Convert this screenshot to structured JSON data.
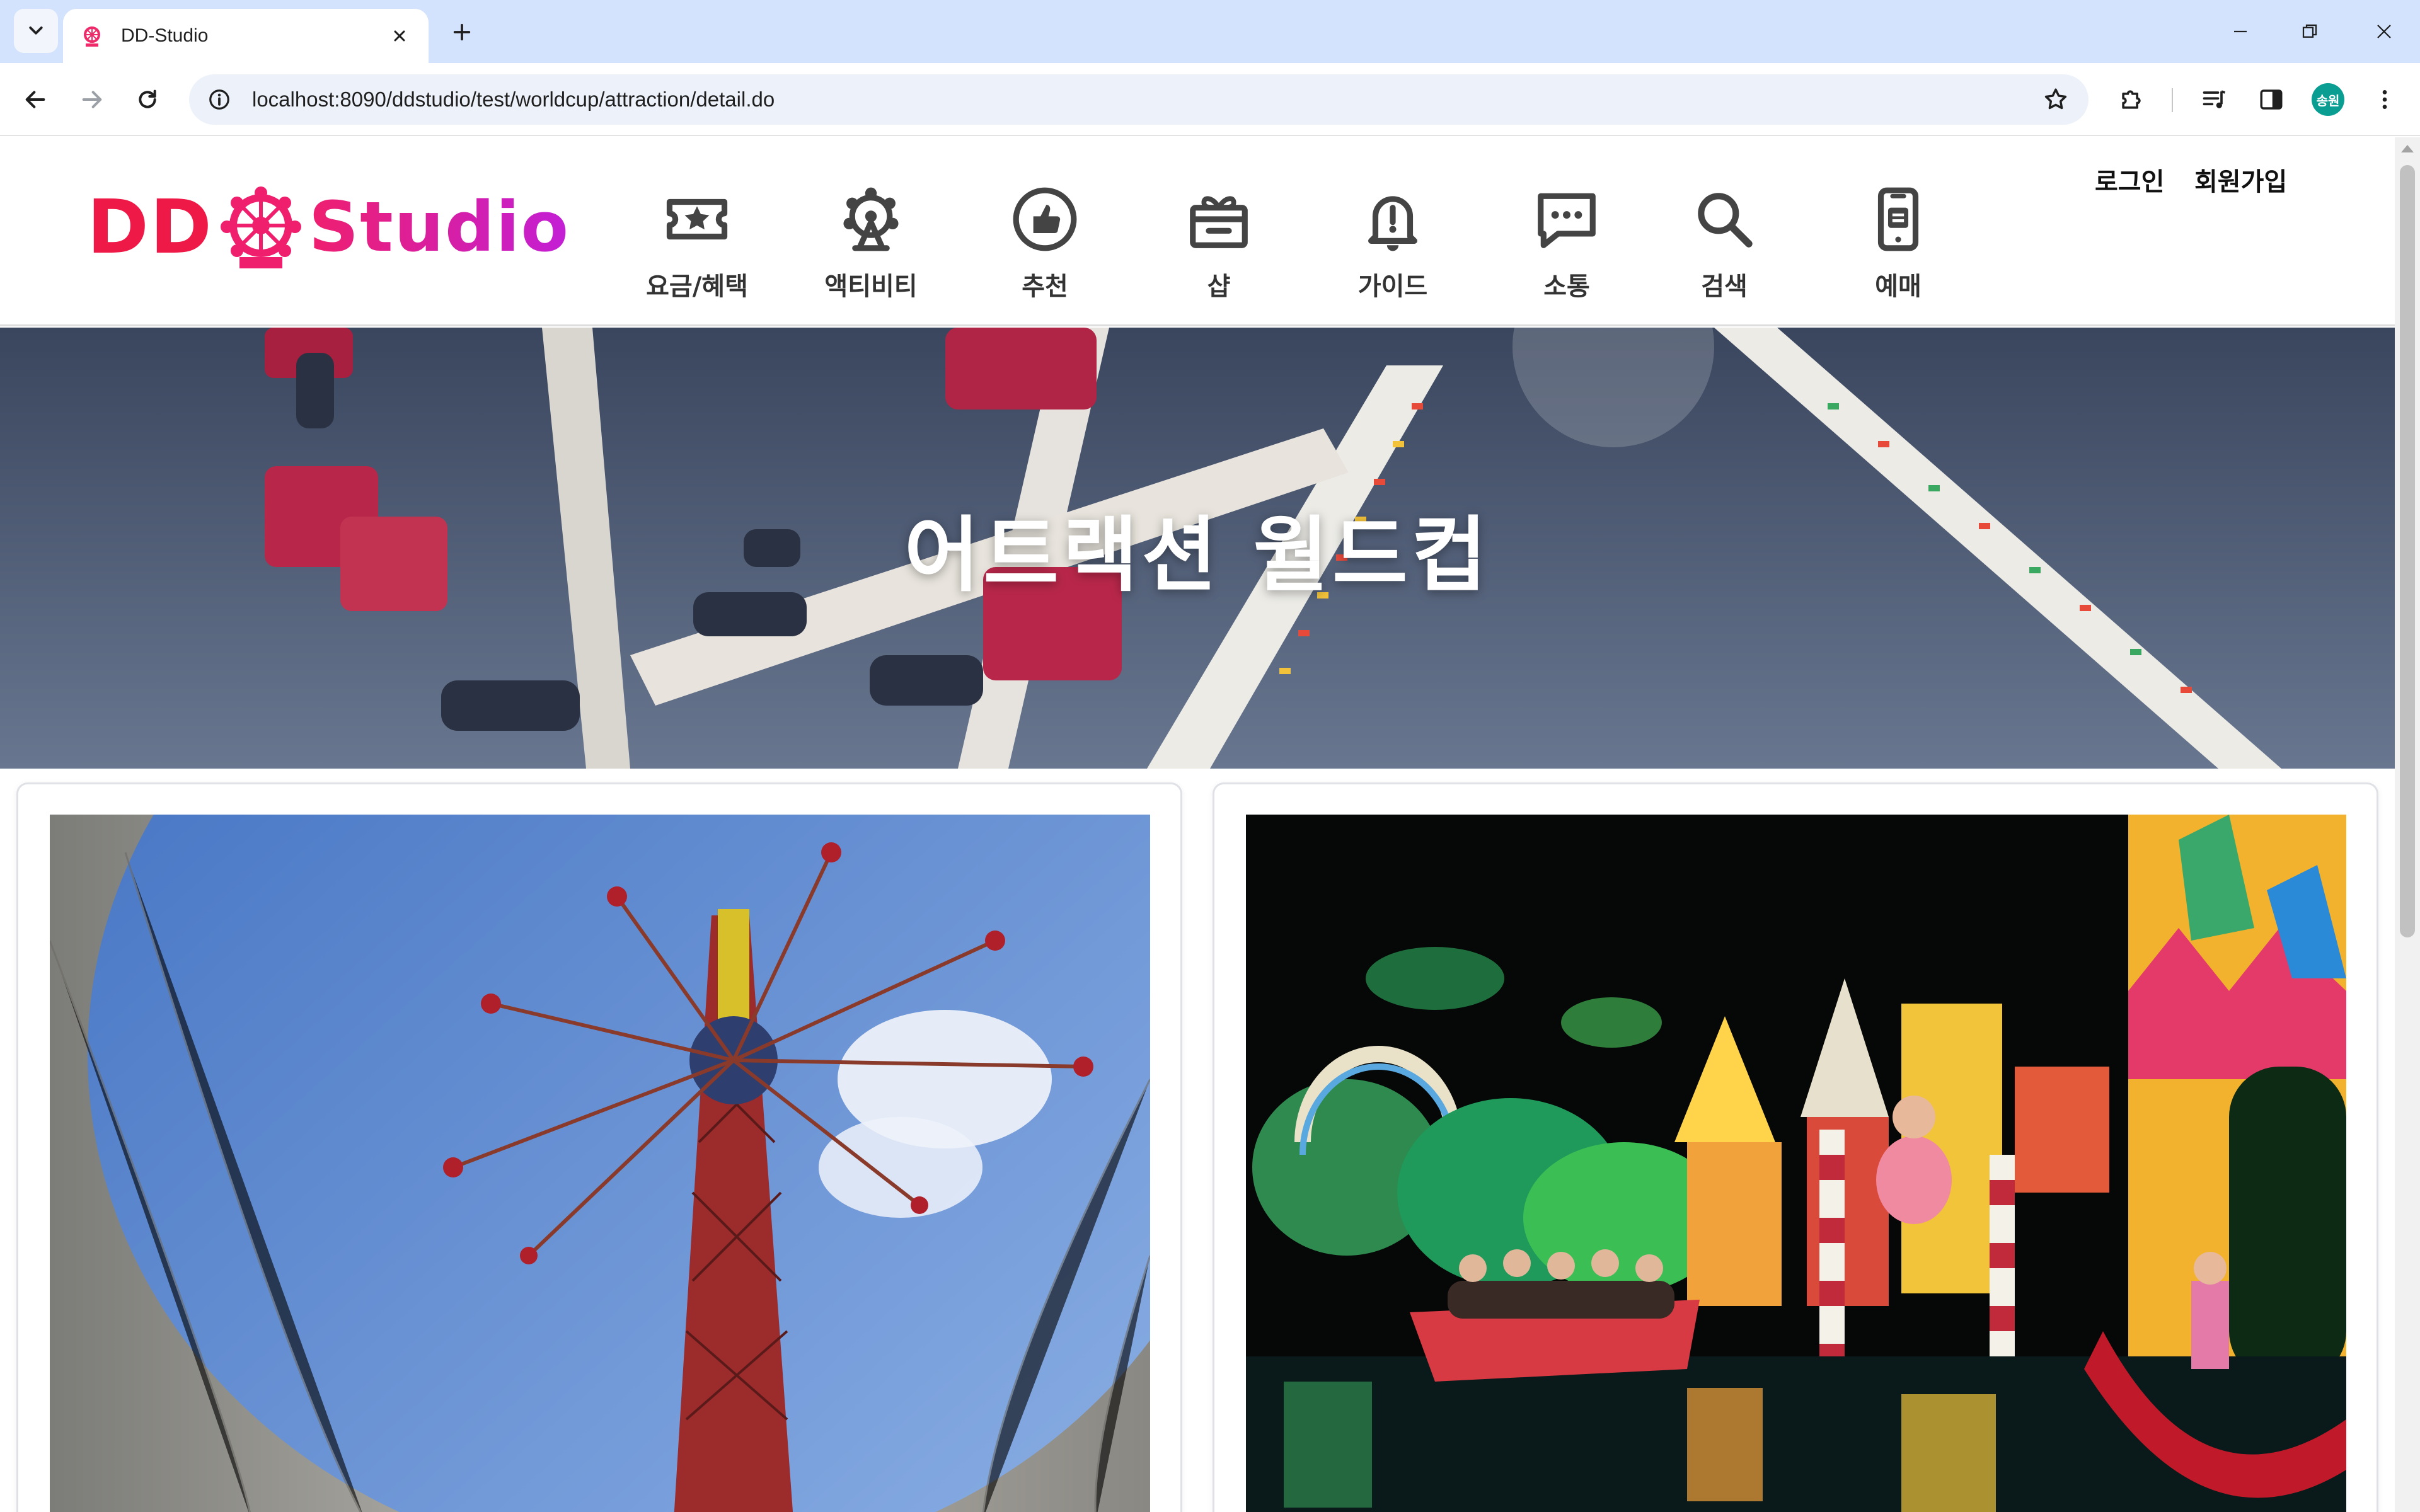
{
  "browser": {
    "tab_title": "DD-Studio",
    "url": "localhost:8090/ddstudio/test/worldcup/attraction/detail.do",
    "profile_initials": "송원"
  },
  "site": {
    "logo": {
      "left": "DD",
      "right": "Studio"
    },
    "nav": [
      {
        "label": "요금/혜택",
        "icon": "ticket-star-icon"
      },
      {
        "label": "액티비티",
        "icon": "ferris-wheel-icon"
      },
      {
        "label": "추천",
        "icon": "thumbs-up-icon"
      },
      {
        "label": "샵",
        "icon": "gift-box-icon"
      },
      {
        "label": "가이드",
        "icon": "bell-alert-icon"
      },
      {
        "label": "소통",
        "icon": "chat-bubble-icon"
      },
      {
        "label": "검색",
        "icon": "search-icon"
      },
      {
        "label": "예매",
        "icon": "mobile-ticket-icon"
      }
    ],
    "auth": {
      "login": "로그인",
      "signup": "회원가입"
    }
  },
  "hero": {
    "title": "어트랙션 월드컵"
  },
  "cards": [
    {
      "image": "swing-ride-tower-photo"
    },
    {
      "image": "boat-ride-dolls-photo"
    }
  ]
}
